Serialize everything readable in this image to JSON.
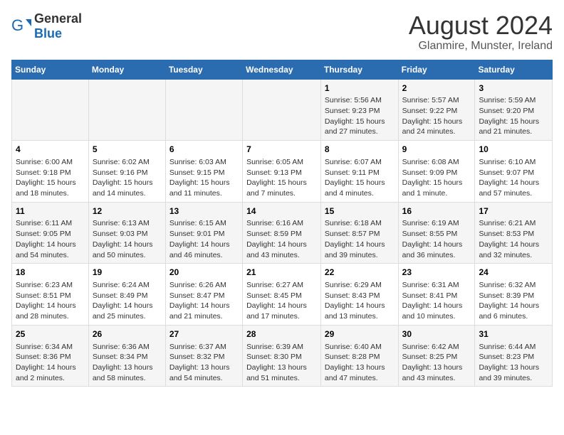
{
  "logo": {
    "text_general": "General",
    "text_blue": "Blue"
  },
  "title": "August 2024",
  "subtitle": "Glanmire, Munster, Ireland",
  "days_of_week": [
    "Sunday",
    "Monday",
    "Tuesday",
    "Wednesday",
    "Thursday",
    "Friday",
    "Saturday"
  ],
  "weeks": [
    [
      {
        "day": "",
        "info": ""
      },
      {
        "day": "",
        "info": ""
      },
      {
        "day": "",
        "info": ""
      },
      {
        "day": "",
        "info": ""
      },
      {
        "day": "1",
        "info": "Sunrise: 5:56 AM\nSunset: 9:23 PM\nDaylight: 15 hours and 27 minutes."
      },
      {
        "day": "2",
        "info": "Sunrise: 5:57 AM\nSunset: 9:22 PM\nDaylight: 15 hours and 24 minutes."
      },
      {
        "day": "3",
        "info": "Sunrise: 5:59 AM\nSunset: 9:20 PM\nDaylight: 15 hours and 21 minutes."
      }
    ],
    [
      {
        "day": "4",
        "info": "Sunrise: 6:00 AM\nSunset: 9:18 PM\nDaylight: 15 hours and 18 minutes."
      },
      {
        "day": "5",
        "info": "Sunrise: 6:02 AM\nSunset: 9:16 PM\nDaylight: 15 hours and 14 minutes."
      },
      {
        "day": "6",
        "info": "Sunrise: 6:03 AM\nSunset: 9:15 PM\nDaylight: 15 hours and 11 minutes."
      },
      {
        "day": "7",
        "info": "Sunrise: 6:05 AM\nSunset: 9:13 PM\nDaylight: 15 hours and 7 minutes."
      },
      {
        "day": "8",
        "info": "Sunrise: 6:07 AM\nSunset: 9:11 PM\nDaylight: 15 hours and 4 minutes."
      },
      {
        "day": "9",
        "info": "Sunrise: 6:08 AM\nSunset: 9:09 PM\nDaylight: 15 hours and 1 minute."
      },
      {
        "day": "10",
        "info": "Sunrise: 6:10 AM\nSunset: 9:07 PM\nDaylight: 14 hours and 57 minutes."
      }
    ],
    [
      {
        "day": "11",
        "info": "Sunrise: 6:11 AM\nSunset: 9:05 PM\nDaylight: 14 hours and 54 minutes."
      },
      {
        "day": "12",
        "info": "Sunrise: 6:13 AM\nSunset: 9:03 PM\nDaylight: 14 hours and 50 minutes."
      },
      {
        "day": "13",
        "info": "Sunrise: 6:15 AM\nSunset: 9:01 PM\nDaylight: 14 hours and 46 minutes."
      },
      {
        "day": "14",
        "info": "Sunrise: 6:16 AM\nSunset: 8:59 PM\nDaylight: 14 hours and 43 minutes."
      },
      {
        "day": "15",
        "info": "Sunrise: 6:18 AM\nSunset: 8:57 PM\nDaylight: 14 hours and 39 minutes."
      },
      {
        "day": "16",
        "info": "Sunrise: 6:19 AM\nSunset: 8:55 PM\nDaylight: 14 hours and 36 minutes."
      },
      {
        "day": "17",
        "info": "Sunrise: 6:21 AM\nSunset: 8:53 PM\nDaylight: 14 hours and 32 minutes."
      }
    ],
    [
      {
        "day": "18",
        "info": "Sunrise: 6:23 AM\nSunset: 8:51 PM\nDaylight: 14 hours and 28 minutes."
      },
      {
        "day": "19",
        "info": "Sunrise: 6:24 AM\nSunset: 8:49 PM\nDaylight: 14 hours and 25 minutes."
      },
      {
        "day": "20",
        "info": "Sunrise: 6:26 AM\nSunset: 8:47 PM\nDaylight: 14 hours and 21 minutes."
      },
      {
        "day": "21",
        "info": "Sunrise: 6:27 AM\nSunset: 8:45 PM\nDaylight: 14 hours and 17 minutes."
      },
      {
        "day": "22",
        "info": "Sunrise: 6:29 AM\nSunset: 8:43 PM\nDaylight: 14 hours and 13 minutes."
      },
      {
        "day": "23",
        "info": "Sunrise: 6:31 AM\nSunset: 8:41 PM\nDaylight: 14 hours and 10 minutes."
      },
      {
        "day": "24",
        "info": "Sunrise: 6:32 AM\nSunset: 8:39 PM\nDaylight: 14 hours and 6 minutes."
      }
    ],
    [
      {
        "day": "25",
        "info": "Sunrise: 6:34 AM\nSunset: 8:36 PM\nDaylight: 14 hours and 2 minutes."
      },
      {
        "day": "26",
        "info": "Sunrise: 6:36 AM\nSunset: 8:34 PM\nDaylight: 13 hours and 58 minutes."
      },
      {
        "day": "27",
        "info": "Sunrise: 6:37 AM\nSunset: 8:32 PM\nDaylight: 13 hours and 54 minutes."
      },
      {
        "day": "28",
        "info": "Sunrise: 6:39 AM\nSunset: 8:30 PM\nDaylight: 13 hours and 51 minutes."
      },
      {
        "day": "29",
        "info": "Sunrise: 6:40 AM\nSunset: 8:28 PM\nDaylight: 13 hours and 47 minutes."
      },
      {
        "day": "30",
        "info": "Sunrise: 6:42 AM\nSunset: 8:25 PM\nDaylight: 13 hours and 43 minutes."
      },
      {
        "day": "31",
        "info": "Sunrise: 6:44 AM\nSunset: 8:23 PM\nDaylight: 13 hours and 39 minutes."
      }
    ]
  ]
}
